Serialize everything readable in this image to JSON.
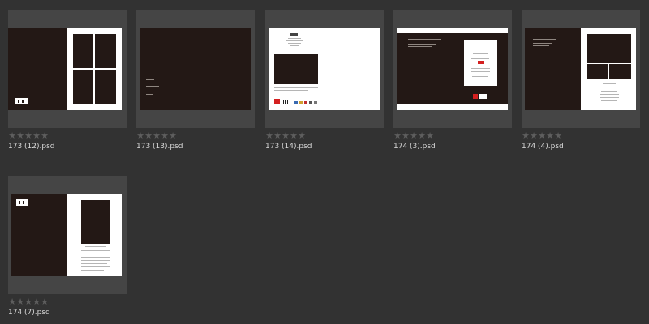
{
  "rating": {
    "max_stars": 5,
    "star_glyph": "★",
    "star_color": "#5e5e5e"
  },
  "theme": {
    "background": "#323232",
    "thumb_background": "#454545",
    "cover_dark": "#231815",
    "accent_red": "#d42020",
    "label_color": "#d8d8d8"
  },
  "files": [
    {
      "name": "173 (12).psd"
    },
    {
      "name": "173 (13).psd"
    },
    {
      "name": "173 (14).psd"
    },
    {
      "name": "174 (3).psd"
    },
    {
      "name": "174 (4).psd"
    },
    {
      "name": "174 (7).psd"
    }
  ]
}
